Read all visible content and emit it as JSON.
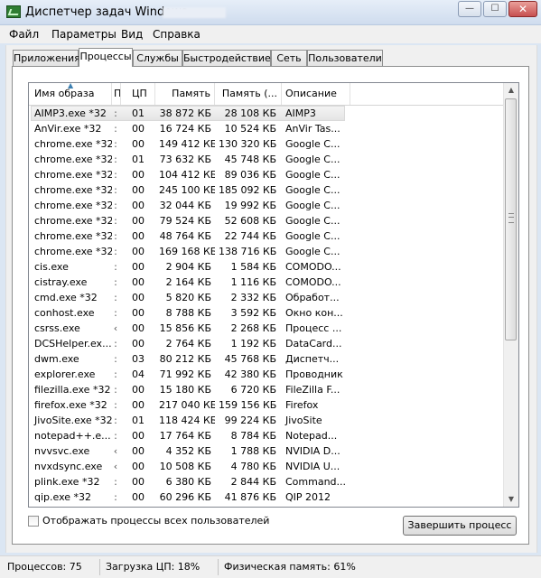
{
  "window": {
    "title": "Диспетчер задач Windows"
  },
  "window_buttons": {
    "minimize": "—",
    "maximize": "☐",
    "close": "✕"
  },
  "menu": [
    "Файл",
    "Параметры",
    "Вид",
    "Справка"
  ],
  "tabs": [
    "Приложения",
    "Процессы",
    "Службы",
    "Быстродействие",
    "Сеть",
    "Пользователи"
  ],
  "active_tab": "Процессы",
  "columns": [
    "Имя образа",
    "П",
    "ЦП",
    "Память",
    "Память (...",
    "Описание"
  ],
  "processes": [
    {
      "name": "AIMP3.exe *32",
      "user": ":",
      "cpu": "01",
      "mem": "38 872 КБ",
      "pmem": "28 108 КБ",
      "desc": "AIMP3"
    },
    {
      "name": "AnVir.exe *32",
      "user": ":",
      "cpu": "00",
      "mem": "16 724 КБ",
      "pmem": "10 524 КБ",
      "desc": "AnVir Tas..."
    },
    {
      "name": "chrome.exe *32",
      "user": ":",
      "cpu": "00",
      "mem": "149 412 КБ",
      "pmem": "130 320 КБ",
      "desc": "Google C..."
    },
    {
      "name": "chrome.exe *32",
      "user": ":",
      "cpu": "01",
      "mem": "73 632 КБ",
      "pmem": "45 748 КБ",
      "desc": "Google C..."
    },
    {
      "name": "chrome.exe *32",
      "user": ":",
      "cpu": "00",
      "mem": "104 412 КБ",
      "pmem": "89 036 КБ",
      "desc": "Google C..."
    },
    {
      "name": "chrome.exe *32",
      "user": ":",
      "cpu": "00",
      "mem": "245 100 КБ",
      "pmem": "185 092 КБ",
      "desc": "Google C..."
    },
    {
      "name": "chrome.exe *32",
      "user": ":",
      "cpu": "00",
      "mem": "32 044 КБ",
      "pmem": "19 992 КБ",
      "desc": "Google C..."
    },
    {
      "name": "chrome.exe *32",
      "user": ":",
      "cpu": "00",
      "mem": "79 524 КБ",
      "pmem": "52 608 КБ",
      "desc": "Google C..."
    },
    {
      "name": "chrome.exe *32",
      "user": ":",
      "cpu": "00",
      "mem": "48 764 КБ",
      "pmem": "22 744 КБ",
      "desc": "Google C..."
    },
    {
      "name": "chrome.exe *32",
      "user": ":",
      "cpu": "00",
      "mem": "169 168 КБ",
      "pmem": "138 716 КБ",
      "desc": "Google C..."
    },
    {
      "name": "cis.exe",
      "user": ":",
      "cpu": "00",
      "mem": "2 904 КБ",
      "pmem": "1 584 КБ",
      "desc": "COMODO..."
    },
    {
      "name": "cistray.exe",
      "user": ":",
      "cpu": "00",
      "mem": "2 164 КБ",
      "pmem": "1 116 КБ",
      "desc": "COMODO..."
    },
    {
      "name": "cmd.exe *32",
      "user": ":",
      "cpu": "00",
      "mem": "5 820 КБ",
      "pmem": "2 332 КБ",
      "desc": "Обработ..."
    },
    {
      "name": "conhost.exe",
      "user": ":",
      "cpu": "00",
      "mem": "8 788 КБ",
      "pmem": "3 592 КБ",
      "desc": "Окно кон..."
    },
    {
      "name": "csrss.exe",
      "user": "‹",
      "cpu": "00",
      "mem": "15 856 КБ",
      "pmem": "2 268 КБ",
      "desc": "Процесс ..."
    },
    {
      "name": "DCSHelper.ex...",
      "user": ":",
      "cpu": "00",
      "mem": "2 764 КБ",
      "pmem": "1 192 КБ",
      "desc": "DataCard..."
    },
    {
      "name": "dwm.exe",
      "user": ":",
      "cpu": "03",
      "mem": "80 212 КБ",
      "pmem": "45 768 КБ",
      "desc": "Диспетч..."
    },
    {
      "name": "explorer.exe",
      "user": ":",
      "cpu": "04",
      "mem": "71 992 КБ",
      "pmem": "42 380 КБ",
      "desc": "Проводник"
    },
    {
      "name": "filezilla.exe *32",
      "user": ":",
      "cpu": "00",
      "mem": "15 180 КБ",
      "pmem": "6 720 КБ",
      "desc": "FileZilla F..."
    },
    {
      "name": "firefox.exe *32",
      "user": ":",
      "cpu": "00",
      "mem": "217 040 КБ",
      "pmem": "159 156 КБ",
      "desc": "Firefox"
    },
    {
      "name": "JivoSite.exe *32",
      "user": ":",
      "cpu": "01",
      "mem": "118 424 КБ",
      "pmem": "99 224 КБ",
      "desc": "JivoSite"
    },
    {
      "name": "notepad++.e...",
      "user": ":",
      "cpu": "00",
      "mem": "17 764 КБ",
      "pmem": "8 784 КБ",
      "desc": "Notepad..."
    },
    {
      "name": "nvvsvc.exe",
      "user": "‹",
      "cpu": "00",
      "mem": "4 352 КБ",
      "pmem": "1 788 КБ",
      "desc": "NVIDIA D..."
    },
    {
      "name": "nvxdsync.exe",
      "user": "‹",
      "cpu": "00",
      "mem": "10 508 КБ",
      "pmem": "4 780 КБ",
      "desc": "NVIDIA U..."
    },
    {
      "name": "plink.exe *32",
      "user": ":",
      "cpu": "00",
      "mem": "6 380 КБ",
      "pmem": "2 844 КБ",
      "desc": "Command..."
    },
    {
      "name": "qip.exe *32",
      "user": ":",
      "cpu": "00",
      "mem": "60 296 КБ",
      "pmem": "41 876 КБ",
      "desc": "QIP 2012"
    }
  ],
  "selected_index": 0,
  "show_all_users_label": "Отображать процессы всех пользователей",
  "show_all_users_checked": false,
  "end_process_label": "Завершить процесс",
  "status": {
    "processes": "Процессов: 75",
    "cpu": "Загрузка ЦП: 18%",
    "memory": "Физическая память: 61%"
  }
}
